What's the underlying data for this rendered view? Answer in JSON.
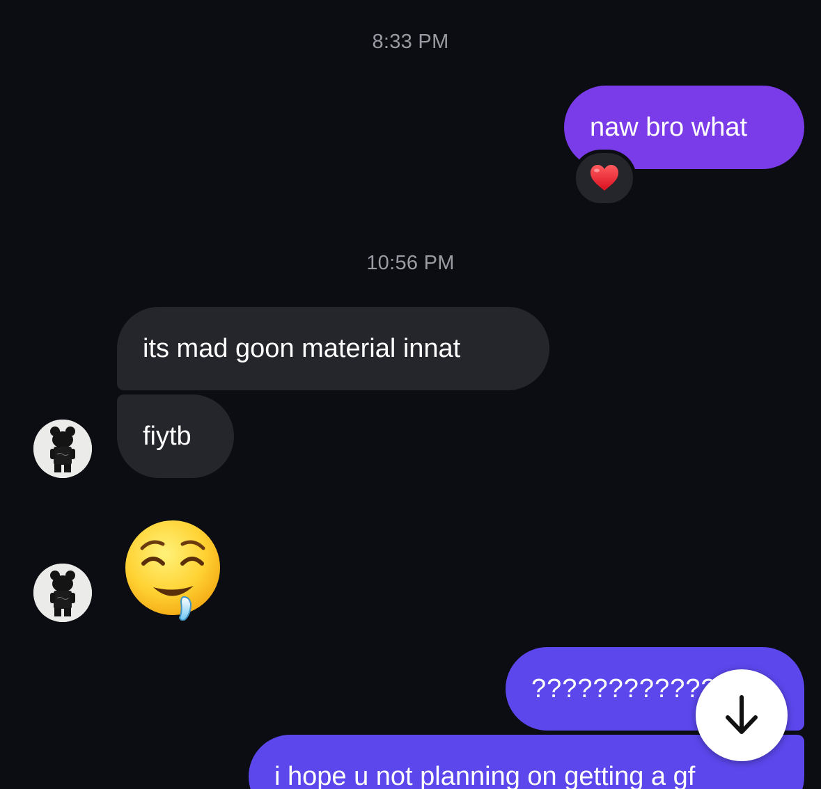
{
  "messages": {
    "ts1": "8:33 PM",
    "m1_text": "naw bro what",
    "m1_reaction": "heart-emoji",
    "ts2": "10:56 PM",
    "m2_text": "its mad goon material innat",
    "m3_text": "fiytb",
    "m4_emoji": "drooling-face-emoji",
    "m5_text": "?????????????",
    "m6_text": "i hope u not planning on getting a gf"
  },
  "controls": {
    "scroll_down_icon": "arrow-down-icon"
  },
  "colors": {
    "background": "#0c0d13",
    "outgoing_violet": "#7a3be9",
    "outgoing_indigo": "#5b47ec",
    "incoming": "#25262c",
    "timestamp": "#9a9ca4"
  }
}
